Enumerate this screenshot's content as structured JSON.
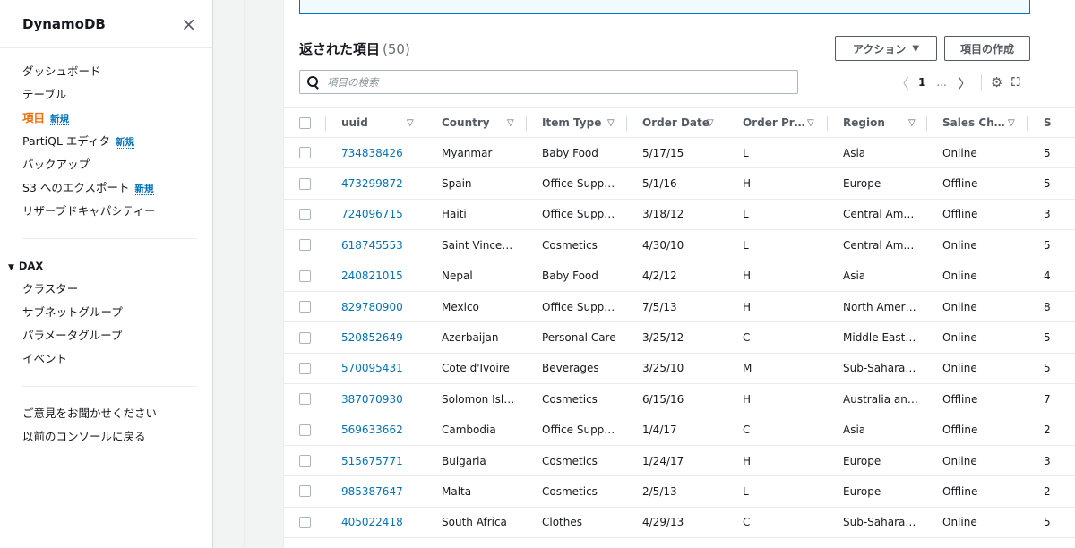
{
  "sidebar": {
    "title": "DynamoDB",
    "close_icon": "×",
    "items": [
      {
        "label": "ダッシュボード"
      },
      {
        "label": "テーブル"
      },
      {
        "label": "項目",
        "badge": "新規",
        "active": true
      },
      {
        "label": "PartiQL エディタ",
        "badge": "新規"
      },
      {
        "label": "バックアップ"
      },
      {
        "label": "S3 へのエクスポート",
        "badge": "新規"
      },
      {
        "label": "リザーブドキャパシティー"
      }
    ],
    "dax": {
      "label": "DAX",
      "items": [
        {
          "label": "クラスター"
        },
        {
          "label": "サブネットグループ"
        },
        {
          "label": "パラメータグループ"
        },
        {
          "label": "イベント"
        }
      ]
    },
    "footer": [
      {
        "label": "ご意見をお聞かせください"
      },
      {
        "label": "以前のコンソールに戻る"
      }
    ]
  },
  "header": {
    "title": "返された項目",
    "count": "(50)",
    "actions_label": "アクション",
    "create_label": "項目の作成"
  },
  "search": {
    "placeholder": "項目の検索"
  },
  "pager": {
    "prev": "〈",
    "page": "1",
    "dots": "...",
    "next": "〉"
  },
  "table": {
    "columns": [
      "uuid",
      "Country",
      "Item Type",
      "Order Date",
      "Order Pr…",
      "Region",
      "Sales Ch…",
      "S"
    ],
    "rows": [
      [
        "734838426",
        "Myanmar",
        "Baby Food",
        "5/17/15",
        "L",
        "Asia",
        "Online",
        "5"
      ],
      [
        "473299872",
        "Spain",
        "Office Supp…",
        "5/1/16",
        "H",
        "Europe",
        "Offline",
        "5"
      ],
      [
        "724096715",
        "Haiti",
        "Office Supp…",
        "3/18/12",
        "L",
        "Central Am…",
        "Offline",
        "3"
      ],
      [
        "618745553",
        "Saint Vince…",
        "Cosmetics",
        "4/30/10",
        "L",
        "Central Am…",
        "Online",
        "5"
      ],
      [
        "240821015",
        "Nepal",
        "Baby Food",
        "4/2/12",
        "H",
        "Asia",
        "Online",
        "4"
      ],
      [
        "829780900",
        "Mexico",
        "Office Supp…",
        "7/5/13",
        "H",
        "North Amer…",
        "Online",
        "8"
      ],
      [
        "520852649",
        "Azerbaijan",
        "Personal Care",
        "3/25/12",
        "C",
        "Middle East…",
        "Online",
        "5"
      ],
      [
        "570095431",
        "Cote d'Ivoire",
        "Beverages",
        "3/25/10",
        "M",
        "Sub-Sahara…",
        "Online",
        "5"
      ],
      [
        "387070930",
        "Solomon Isl…",
        "Cosmetics",
        "6/15/16",
        "H",
        "Australia an…",
        "Offline",
        "7"
      ],
      [
        "569633662",
        "Cambodia",
        "Office Supp…",
        "1/4/17",
        "C",
        "Asia",
        "Offline",
        "2"
      ],
      [
        "515675771",
        "Bulgaria",
        "Cosmetics",
        "1/24/17",
        "H",
        "Europe",
        "Online",
        "3"
      ],
      [
        "985387647",
        "Malta",
        "Cosmetics",
        "2/5/13",
        "L",
        "Europe",
        "Offline",
        "2"
      ],
      [
        "405022418",
        "South Africa",
        "Clothes",
        "4/29/13",
        "C",
        "Sub-Sahara…",
        "Online",
        "5"
      ]
    ]
  },
  "colors": {
    "accent_orange": "#ec7211",
    "link_blue": "#0073bb",
    "text": "#16191f",
    "muted": "#545b64"
  }
}
